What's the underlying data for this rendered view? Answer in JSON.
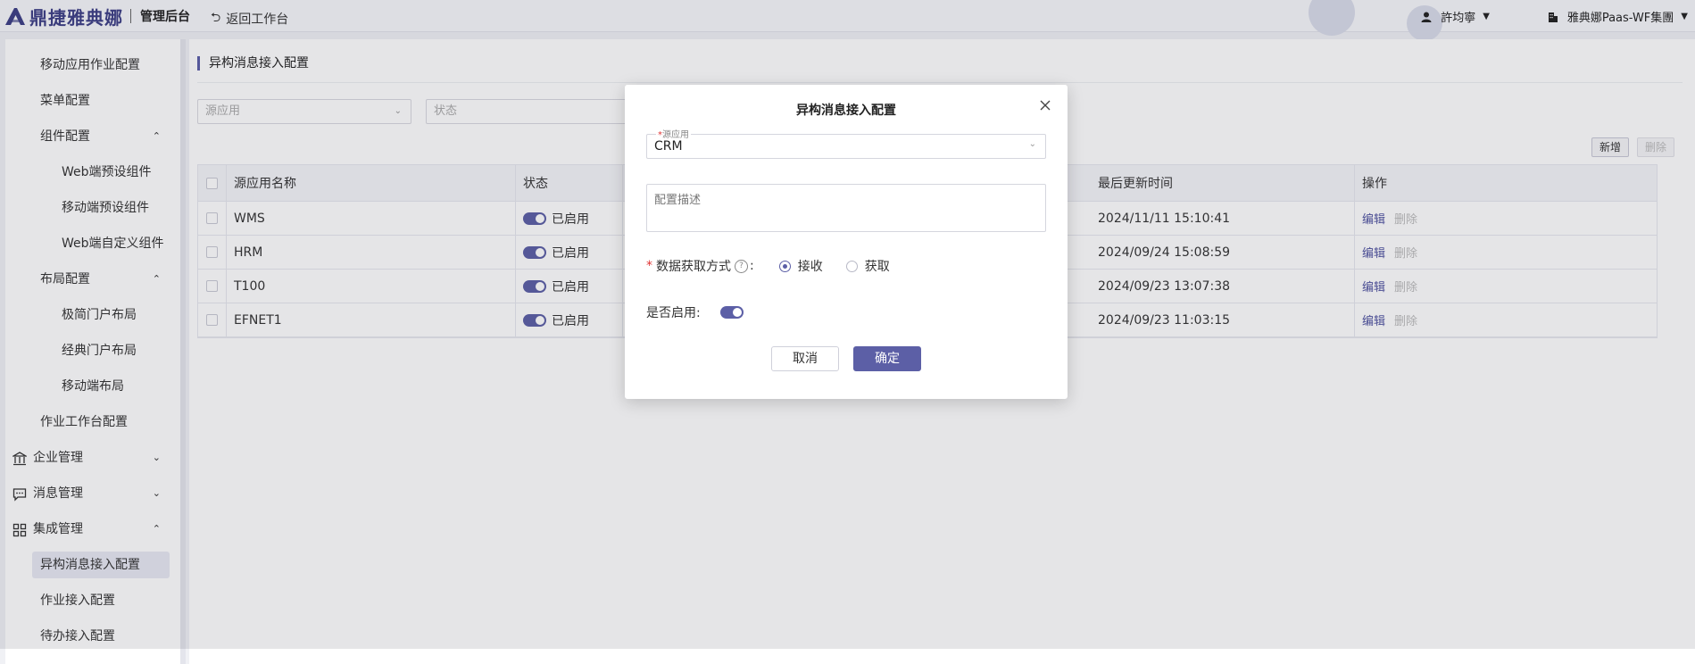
{
  "header": {
    "logo_text": "鼎捷雅典娜",
    "admin_title": "管理后台",
    "back_label": "返回工作台",
    "user_name": "許均寧",
    "org_name": "雅典娜Paas-WF集團"
  },
  "sidebar": {
    "items": [
      {
        "label": "移动应用作业配置"
      },
      {
        "label": "菜单配置"
      },
      {
        "label": "组件配置"
      },
      {
        "label": "Web端预设组件"
      },
      {
        "label": "移动端预设组件"
      },
      {
        "label": "Web端自定义组件"
      },
      {
        "label": "布局配置"
      },
      {
        "label": "极简门户布局"
      },
      {
        "label": "经典门户布局"
      },
      {
        "label": "移动端布局"
      },
      {
        "label": "作业工作台配置"
      },
      {
        "label": "企业管理"
      },
      {
        "label": "消息管理"
      },
      {
        "label": "集成管理"
      },
      {
        "label": "异构消息接入配置"
      },
      {
        "label": "作业接入配置"
      },
      {
        "label": "待办接入配置"
      }
    ]
  },
  "main": {
    "title": "异构消息接入配置",
    "filter_app_placeholder": "源应用",
    "filter_status_placeholder": "状态",
    "add_label": "新增",
    "delete_label": "删除",
    "columns": {
      "app_name": "源应用名称",
      "status": "状态",
      "updated": "最后更新时间",
      "actions": "操作"
    },
    "rows": [
      {
        "app": "WMS",
        "status": "已启用",
        "updated": "2024/11/11 15:10:41",
        "edit": "编辑",
        "del": "删除"
      },
      {
        "app": "HRM",
        "status": "已启用",
        "updated": "2024/09/24 15:08:59",
        "edit": "编辑",
        "del": "删除"
      },
      {
        "app": "T100",
        "status": "已启用",
        "updated": "2024/09/23 13:07:38",
        "edit": "编辑",
        "del": "删除"
      },
      {
        "app": "EFNET1",
        "status": "已启用",
        "updated": "2024/09/23 11:03:15",
        "edit": "编辑",
        "del": "删除"
      }
    ]
  },
  "modal": {
    "title": "异构消息接入配置",
    "source_label": "源应用",
    "source_value": "CRM",
    "desc_placeholder": "配置描述",
    "fetch_label": "数据获取方式",
    "fetch_colon": ":",
    "help_glyph": "?",
    "option_receive": "接收",
    "option_fetch": "获取",
    "enable_label": "是否启用:",
    "cancel_label": "取消",
    "ok_label": "确定"
  },
  "colors": {
    "accent": "#5c5fa6",
    "brand": "#3d3f86",
    "required": "#e03535"
  },
  "icons": {
    "logo": "athena-a-logo-icon",
    "back": "undo-icon",
    "user": "user-icon",
    "org": "building-icon",
    "close": "close-icon",
    "enterprise": "bank-icon",
    "message": "chat-icon",
    "integration": "grid-icon"
  }
}
